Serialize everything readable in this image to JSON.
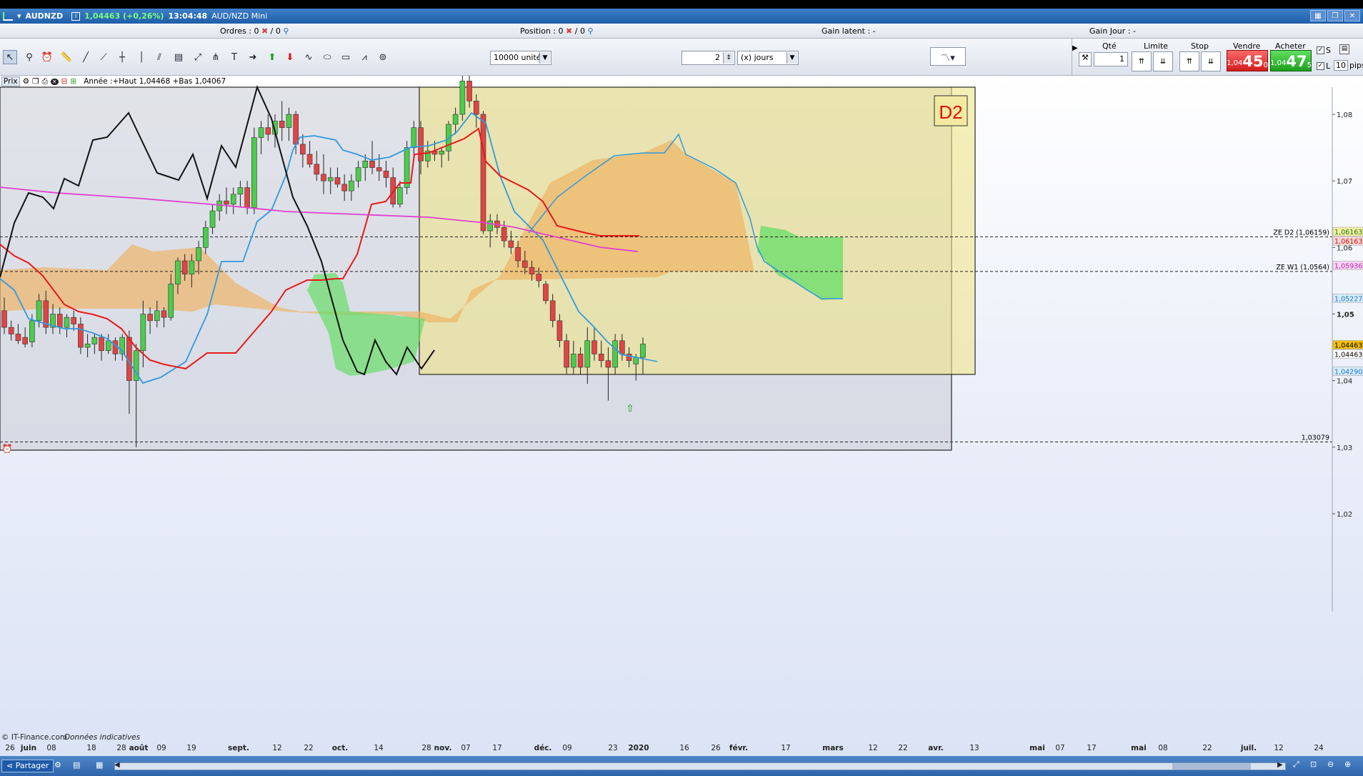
{
  "titlebar": {
    "symbol": "AUDNZD",
    "price": "1,04463 (+0,26%)",
    "time": "13:04:48",
    "name": "AUD/NZD Mini"
  },
  "infobar": {
    "orders_label": "Ordres : 0",
    "orders_sep": "/ 0",
    "position_label": "Position : 0",
    "position_sep": "/ 0",
    "gain_latent": "Gain latent : -",
    "gain_jour": "Gain Jour : -"
  },
  "toolbar": {
    "units": "10000 unités",
    "period_value": "2",
    "period_unit": "(x) jours"
  },
  "orderpanel": {
    "qte_label": "Qté",
    "qte_value": "1",
    "limite_label": "Limite",
    "stop_label": "Stop",
    "vendre_label": "Vendre",
    "acheter_label": "Acheter",
    "sell_small": "1,04",
    "sell_big": "45",
    "sell_sup": "0",
    "buy_small": "1,04",
    "buy_big": "47",
    "buy_sup": "5",
    "check_s": "S",
    "check_l": "L",
    "pips_value": "10",
    "pips_label": "pips"
  },
  "chart": {
    "header_tag": "Prix",
    "header_text": "Année :+Haut 1,04468 +Bas 1,04067",
    "zone_label": "D2",
    "copyright": "© IT-Finance.com",
    "disclaimer": "Données indicatives",
    "line_labels": [
      {
        "text": "ZE D2 (1,06159)",
        "color": "#000000"
      },
      {
        "text": "ZE W1 (1,0564)",
        "color": "#000000"
      },
      {
        "text": "1,03079",
        "color": "#000000"
      }
    ],
    "price_tags": [
      {
        "text": "1,06163",
        "bg": "#f5f0a0",
        "fg": "#1a7a1a"
      },
      {
        "text": "1,06163",
        "bg": "#f7d9d9",
        "fg": "#d01010"
      },
      {
        "text": "1,05936",
        "bg": "#f8d8f4",
        "fg": "#c020b0"
      },
      {
        "text": "1,05227",
        "bg": "#d8ecfa",
        "fg": "#1a78d0"
      },
      {
        "text": "1,04463",
        "bg": "#f5c000",
        "fg": "#000000"
      },
      {
        "text": "1,04463",
        "bg": "#ffffff",
        "fg": "#000000"
      },
      {
        "text": "1,04290",
        "bg": "#d8ecfa",
        "fg": "#1a78d0"
      }
    ],
    "y_ticks": [
      "1,08",
      "1,07",
      "1,06",
      "1,05",
      "1,04",
      "1,03",
      "1,02"
    ],
    "x_ticks": [
      "26",
      "juin",
      "08",
      "18",
      "28",
      "août",
      "09",
      "19",
      "sept.",
      "12",
      "22",
      "oct.",
      "14",
      "28",
      "nov.",
      "07",
      "17",
      "déc.",
      "09",
      "23",
      "2020",
      "16",
      "26",
      "févr.",
      "17",
      "mars",
      "12",
      "22",
      "avr.",
      "13",
      "mai",
      "07",
      "17",
      "mai",
      "08",
      "22",
      "juil.",
      "12",
      "24"
    ],
    "chart_data": {
      "type": "candlestick",
      "title": "AUD/NZD Mini",
      "ylim": [
        1.015,
        1.085
      ],
      "candles": [
        {
          "o": 1.0505,
          "h": 1.0525,
          "l": 1.047,
          "c": 1.048
        },
        {
          "o": 1.048,
          "h": 1.049,
          "l": 1.046,
          "c": 1.047
        },
        {
          "o": 1.047,
          "h": 1.0485,
          "l": 1.0455,
          "c": 1.046
        },
        {
          "o": 1.0465,
          "h": 1.048,
          "l": 1.045,
          "c": 1.0455
        },
        {
          "o": 1.0458,
          "h": 1.05,
          "l": 1.045,
          "c": 1.049
        },
        {
          "o": 1.049,
          "h": 1.053,
          "l": 1.048,
          "c": 1.052
        },
        {
          "o": 1.052,
          "h": 1.0535,
          "l": 1.047,
          "c": 1.048
        },
        {
          "o": 1.048,
          "h": 1.0515,
          "l": 1.047,
          "c": 1.05
        },
        {
          "o": 1.05,
          "h": 1.051,
          "l": 1.047,
          "c": 1.048
        },
        {
          "o": 1.048,
          "h": 1.05,
          "l": 1.0465,
          "c": 1.0495
        },
        {
          "o": 1.0495,
          "h": 1.0505,
          "l": 1.0475,
          "c": 1.0485
        },
        {
          "o": 1.0485,
          "h": 1.0495,
          "l": 1.044,
          "c": 1.045
        },
        {
          "o": 1.045,
          "h": 1.047,
          "l": 1.0435,
          "c": 1.0455
        },
        {
          "o": 1.0455,
          "h": 1.047,
          "l": 1.044,
          "c": 1.0465
        },
        {
          "o": 1.0465,
          "h": 1.047,
          "l": 1.043,
          "c": 1.0445
        },
        {
          "o": 1.0445,
          "h": 1.047,
          "l": 1.044,
          "c": 1.046
        },
        {
          "o": 1.046,
          "h": 1.0465,
          "l": 1.043,
          "c": 1.044
        },
        {
          "o": 1.044,
          "h": 1.047,
          "l": 1.043,
          "c": 1.0465
        },
        {
          "o": 1.0465,
          "h": 1.0475,
          "l": 1.035,
          "c": 1.04
        },
        {
          "o": 1.04,
          "h": 1.0455,
          "l": 1.03,
          "c": 1.0445
        },
        {
          "o": 1.0445,
          "h": 1.052,
          "l": 1.042,
          "c": 1.05
        },
        {
          "o": 1.05,
          "h": 1.051,
          "l": 1.047,
          "c": 1.049
        },
        {
          "o": 1.049,
          "h": 1.052,
          "l": 1.048,
          "c": 1.0505
        },
        {
          "o": 1.0505,
          "h": 1.051,
          "l": 1.048,
          "c": 1.0495
        },
        {
          "o": 1.0495,
          "h": 1.056,
          "l": 1.049,
          "c": 1.0545
        },
        {
          "o": 1.0545,
          "h": 1.0585,
          "l": 1.053,
          "c": 1.058
        },
        {
          "o": 1.058,
          "h": 1.059,
          "l": 1.055,
          "c": 1.056
        },
        {
          "o": 1.056,
          "h": 1.059,
          "l": 1.054,
          "c": 1.058
        },
        {
          "o": 1.058,
          "h": 1.061,
          "l": 1.056,
          "c": 1.06
        },
        {
          "o": 1.06,
          "h": 1.064,
          "l": 1.059,
          "c": 1.063
        },
        {
          "o": 1.063,
          "h": 1.0665,
          "l": 1.062,
          "c": 1.0655
        },
        {
          "o": 1.0655,
          "h": 1.068,
          "l": 1.064,
          "c": 1.067
        },
        {
          "o": 1.067,
          "h": 1.069,
          "l": 1.065,
          "c": 1.0665
        },
        {
          "o": 1.0665,
          "h": 1.069,
          "l": 1.065,
          "c": 1.068
        },
        {
          "o": 1.068,
          "h": 1.07,
          "l": 1.066,
          "c": 1.069
        },
        {
          "o": 1.069,
          "h": 1.07,
          "l": 1.065,
          "c": 1.066
        },
        {
          "o": 1.066,
          "h": 1.078,
          "l": 1.065,
          "c": 1.0765
        },
        {
          "o": 1.0765,
          "h": 1.079,
          "l": 1.074,
          "c": 1.078
        },
        {
          "o": 1.078,
          "h": 1.08,
          "l": 1.076,
          "c": 1.077
        },
        {
          "o": 1.077,
          "h": 1.08,
          "l": 1.075,
          "c": 1.079
        },
        {
          "o": 1.079,
          "h": 1.082,
          "l": 1.076,
          "c": 1.078
        },
        {
          "o": 1.078,
          "h": 1.081,
          "l": 1.076,
          "c": 1.08
        },
        {
          "o": 1.08,
          "h": 1.0805,
          "l": 1.074,
          "c": 1.0755
        },
        {
          "o": 1.0755,
          "h": 1.077,
          "l": 1.072,
          "c": 1.074
        },
        {
          "o": 1.074,
          "h": 1.076,
          "l": 1.072,
          "c": 1.0725
        },
        {
          "o": 1.0725,
          "h": 1.0745,
          "l": 1.07,
          "c": 1.071
        },
        {
          "o": 1.071,
          "h": 1.074,
          "l": 1.068,
          "c": 1.07
        },
        {
          "o": 1.07,
          "h": 1.072,
          "l": 1.068,
          "c": 1.0705
        },
        {
          "o": 1.0705,
          "h": 1.072,
          "l": 1.069,
          "c": 1.0695
        },
        {
          "o": 1.0695,
          "h": 1.071,
          "l": 1.067,
          "c": 1.0685
        },
        {
          "o": 1.0685,
          "h": 1.071,
          "l": 1.067,
          "c": 1.07
        },
        {
          "o": 1.07,
          "h": 1.073,
          "l": 1.069,
          "c": 1.072
        },
        {
          "o": 1.072,
          "h": 1.074,
          "l": 1.07,
          "c": 1.073
        },
        {
          "o": 1.073,
          "h": 1.076,
          "l": 1.071,
          "c": 1.072
        },
        {
          "o": 1.072,
          "h": 1.074,
          "l": 1.07,
          "c": 1.0715
        },
        {
          "o": 1.0715,
          "h": 1.073,
          "l": 1.069,
          "c": 1.0705
        },
        {
          "o": 1.0705,
          "h": 1.072,
          "l": 1.066,
          "c": 1.0665
        },
        {
          "o": 1.0665,
          "h": 1.07,
          "l": 1.066,
          "c": 1.069
        },
        {
          "o": 1.069,
          "h": 1.076,
          "l": 1.068,
          "c": 1.075
        },
        {
          "o": 1.075,
          "h": 1.079,
          "l": 1.073,
          "c": 1.078
        },
        {
          "o": 1.078,
          "h": 1.079,
          "l": 1.071,
          "c": 1.073
        },
        {
          "o": 1.073,
          "h": 1.076,
          "l": 1.072,
          "c": 1.0745
        },
        {
          "o": 1.0745,
          "h": 1.076,
          "l": 1.073,
          "c": 1.074
        },
        {
          "o": 1.074,
          "h": 1.075,
          "l": 1.072,
          "c": 1.0745
        },
        {
          "o": 1.0745,
          "h": 1.079,
          "l": 1.073,
          "c": 1.0785
        },
        {
          "o": 1.0785,
          "h": 1.081,
          "l": 1.077,
          "c": 1.08
        },
        {
          "o": 1.08,
          "h": 1.086,
          "l": 1.079,
          "c": 1.085
        },
        {
          "o": 1.085,
          "h": 1.086,
          "l": 1.081,
          "c": 1.082
        },
        {
          "o": 1.082,
          "h": 1.083,
          "l": 1.078,
          "c": 1.08
        },
        {
          "o": 1.08,
          "h": 1.0805,
          "l": 1.062,
          "c": 1.0625
        },
        {
          "o": 1.0625,
          "h": 1.065,
          "l": 1.06,
          "c": 1.064
        },
        {
          "o": 1.064,
          "h": 1.065,
          "l": 1.062,
          "c": 1.063
        },
        {
          "o": 1.063,
          "h": 1.064,
          "l": 1.06,
          "c": 1.061
        },
        {
          "o": 1.061,
          "h": 1.0625,
          "l": 1.059,
          "c": 1.06
        },
        {
          "o": 1.06,
          "h": 1.061,
          "l": 1.057,
          "c": 1.058
        },
        {
          "o": 1.058,
          "h": 1.0595,
          "l": 1.056,
          "c": 1.057
        },
        {
          "o": 1.057,
          "h": 1.058,
          "l": 1.055,
          "c": 1.056
        },
        {
          "o": 1.056,
          "h": 1.057,
          "l": 1.054,
          "c": 1.055
        },
        {
          "o": 1.0545,
          "h": 1.055,
          "l": 1.0515,
          "c": 1.052
        },
        {
          "o": 1.052,
          "h": 1.053,
          "l": 1.048,
          "c": 1.049
        },
        {
          "o": 1.049,
          "h": 1.05,
          "l": 1.045,
          "c": 1.046
        },
        {
          "o": 1.046,
          "h": 1.047,
          "l": 1.041,
          "c": 1.042
        },
        {
          "o": 1.042,
          "h": 1.046,
          "l": 1.041,
          "c": 1.044
        },
        {
          "o": 1.044,
          "h": 1.045,
          "l": 1.041,
          "c": 1.042
        },
        {
          "o": 1.042,
          "h": 1.048,
          "l": 1.0395,
          "c": 1.046
        },
        {
          "o": 1.046,
          "h": 1.048,
          "l": 1.043,
          "c": 1.044
        },
        {
          "o": 1.044,
          "h": 1.046,
          "l": 1.042,
          "c": 1.043
        },
        {
          "o": 1.043,
          "h": 1.045,
          "l": 1.037,
          "c": 1.042
        },
        {
          "o": 1.042,
          "h": 1.047,
          "l": 1.041,
          "c": 1.046
        },
        {
          "o": 1.046,
          "h": 1.047,
          "l": 1.043,
          "c": 1.044
        },
        {
          "o": 1.044,
          "h": 1.045,
          "l": 1.042,
          "c": 1.043
        },
        {
          "o": 1.0425,
          "h": 1.044,
          "l": 1.04,
          "c": 1.0435
        },
        {
          "o": 1.0435,
          "h": 1.0465,
          "l": 1.041,
          "c": 1.0455
        }
      ]
    }
  },
  "bottombar": {
    "share_label": "Partager"
  }
}
